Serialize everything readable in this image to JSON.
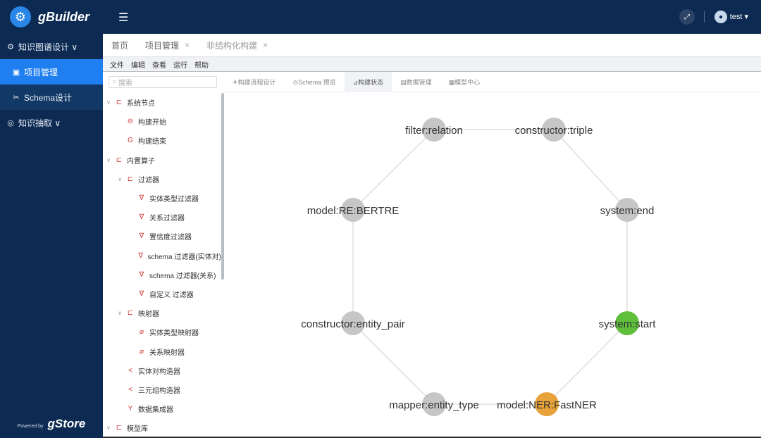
{
  "app": {
    "name": "gBuilder",
    "powered_prefix": "Powered by",
    "powered_name": "gStore"
  },
  "sidebar": {
    "items": [
      {
        "label": "知识图谱设计 ∨",
        "icon": "gear-icon"
      },
      {
        "label": "项目管理",
        "icon": "folder-icon"
      },
      {
        "label": "Schema设计",
        "icon": "schema-icon"
      },
      {
        "label": "知识抽取 ∨",
        "icon": "extract-icon"
      }
    ]
  },
  "topbar": {
    "username": "test ▾"
  },
  "page_tabs": [
    {
      "label": "首页"
    },
    {
      "label": "项目管理",
      "close": "×"
    },
    {
      "label": "非结构化构建",
      "close": "×"
    }
  ],
  "menubar": [
    "文件",
    "编辑",
    "查看",
    "运行",
    "帮助"
  ],
  "search": {
    "placeholder": "搜索"
  },
  "tree": [
    {
      "label": "系统节点",
      "level": 0,
      "icon": "folder-icon",
      "caret": true
    },
    {
      "label": "构建开始",
      "level": 1,
      "icon": "start-icon"
    },
    {
      "label": "构建结束",
      "level": 1,
      "icon": "end-icon"
    },
    {
      "label": "内置算子",
      "level": 0,
      "icon": "folder-icon",
      "caret": true
    },
    {
      "label": "过滤器",
      "level": 1,
      "icon": "folder-icon",
      "caret": true
    },
    {
      "label": "实体类型过滤器",
      "level": 2,
      "icon": "filter-icon"
    },
    {
      "label": "关系过滤器",
      "level": 2,
      "icon": "filter-icon"
    },
    {
      "label": "置信度过滤器",
      "level": 2,
      "icon": "filter-icon"
    },
    {
      "label": "schema 过滤器(实体对)",
      "level": 2,
      "icon": "filter-icon"
    },
    {
      "label": "schema 过滤器(关系)",
      "level": 2,
      "icon": "filter-icon"
    },
    {
      "label": "自定义 过滤器",
      "level": 2,
      "icon": "filter-icon"
    },
    {
      "label": "映射器",
      "level": 1,
      "icon": "folder-icon",
      "caret": true
    },
    {
      "label": "实体类型映射器",
      "level": 2,
      "icon": "link-icon"
    },
    {
      "label": "关系映射器",
      "level": 2,
      "icon": "link-icon"
    },
    {
      "label": "实体对构造器",
      "level": 1,
      "icon": "share-icon"
    },
    {
      "label": "三元组构造器",
      "level": 1,
      "icon": "share-icon"
    },
    {
      "label": "数据集成器",
      "level": 1,
      "icon": "merge-icon"
    },
    {
      "label": "模型库",
      "level": 0,
      "icon": "folder-icon",
      "caret": true
    }
  ],
  "canvas_tabs": [
    {
      "label": "✈构建流程设计"
    },
    {
      "label": "⊙Schema 预览"
    },
    {
      "label": "⊿构建状态",
      "active": true
    },
    {
      "label": "▤数据管理"
    },
    {
      "label": "▦模型中心"
    }
  ],
  "graph": {
    "colors": {
      "idle": "#c6c6c6",
      "running": "#e8a23a",
      "done": "#5fbf3a",
      "edge": "#d0d0d0"
    },
    "nodes": [
      {
        "id": "system:start",
        "label": "system:start",
        "status": "done"
      },
      {
        "id": "model:NER:FastNER",
        "label": "model:NER:FastNER",
        "status": "running"
      },
      {
        "id": "mapper:entity_type",
        "label": "mapper:entity_type",
        "status": "idle"
      },
      {
        "id": "constructor:entity_pair",
        "label": "constructor:entity_pair",
        "status": "idle"
      },
      {
        "id": "model:RE:BERTRE",
        "label": "model:RE:BERTRE",
        "status": "idle"
      },
      {
        "id": "filter:relation",
        "label": "filter:relation",
        "status": "idle"
      },
      {
        "id": "constructor:triple",
        "label": "constructor:triple",
        "status": "idle"
      },
      {
        "id": "system:end",
        "label": "system:end",
        "status": "idle"
      }
    ],
    "edges": [
      [
        "system:start",
        "model:NER:FastNER"
      ],
      [
        "model:NER:FastNER",
        "mapper:entity_type"
      ],
      [
        "mapper:entity_type",
        "constructor:entity_pair"
      ],
      [
        "constructor:entity_pair",
        "model:RE:BERTRE"
      ],
      [
        "model:RE:BERTRE",
        "filter:relation"
      ],
      [
        "filter:relation",
        "constructor:triple"
      ],
      [
        "constructor:triple",
        "system:end"
      ],
      [
        "system:end",
        "system:start"
      ]
    ]
  }
}
